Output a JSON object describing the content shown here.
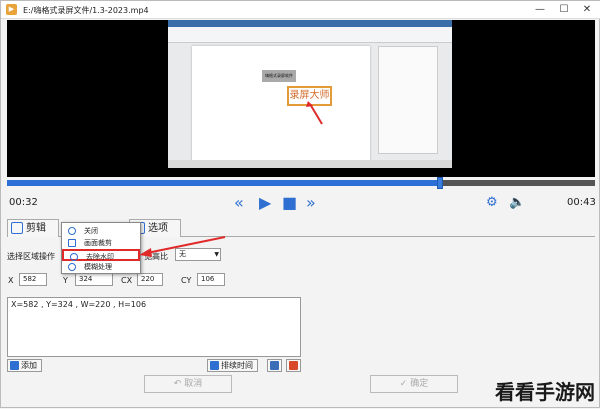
{
  "window": {
    "title": "E:/嗨格式录屏文件/1.3-2023.mp4",
    "minimize": "—",
    "maximize": "☐",
    "close": "✕"
  },
  "video": {
    "watermark_text": "录屏大师",
    "doc_box_text": "嗨格式录屏软件"
  },
  "player": {
    "progress_fraction": 0.737,
    "time_current": "00:32",
    "time_total": "00:43"
  },
  "tabs": [
    {
      "label": "剪辑"
    },
    {
      "label": "选项"
    }
  ],
  "dropdown_menu": {
    "items": [
      {
        "label": "关闭"
      },
      {
        "label": "画面裁剪"
      },
      {
        "label": "去除水印"
      },
      {
        "label": "模糊处理"
      }
    ],
    "highlighted_index": 2
  },
  "region": {
    "label": "选择区域操作",
    "aspect_label": "宽高比",
    "aspect_value": "无"
  },
  "coords": {
    "x_label": "X",
    "x_value": "582",
    "y_label": "Y",
    "y_value": "324",
    "cx_label": "CX",
    "cx_value": "220",
    "cy_label": "CY",
    "cy_value": "106"
  },
  "list_text": "X=582 , Y=324 , W=220 , H=106",
  "buttons": {
    "add": "添加",
    "sort_time": "排续时间",
    "cancel": "取消",
    "confirm": "确定"
  },
  "colors": {
    "accent": "#2f6fd1",
    "annotation_red": "#e02a2a"
  },
  "brand_watermark": "看看手游网"
}
